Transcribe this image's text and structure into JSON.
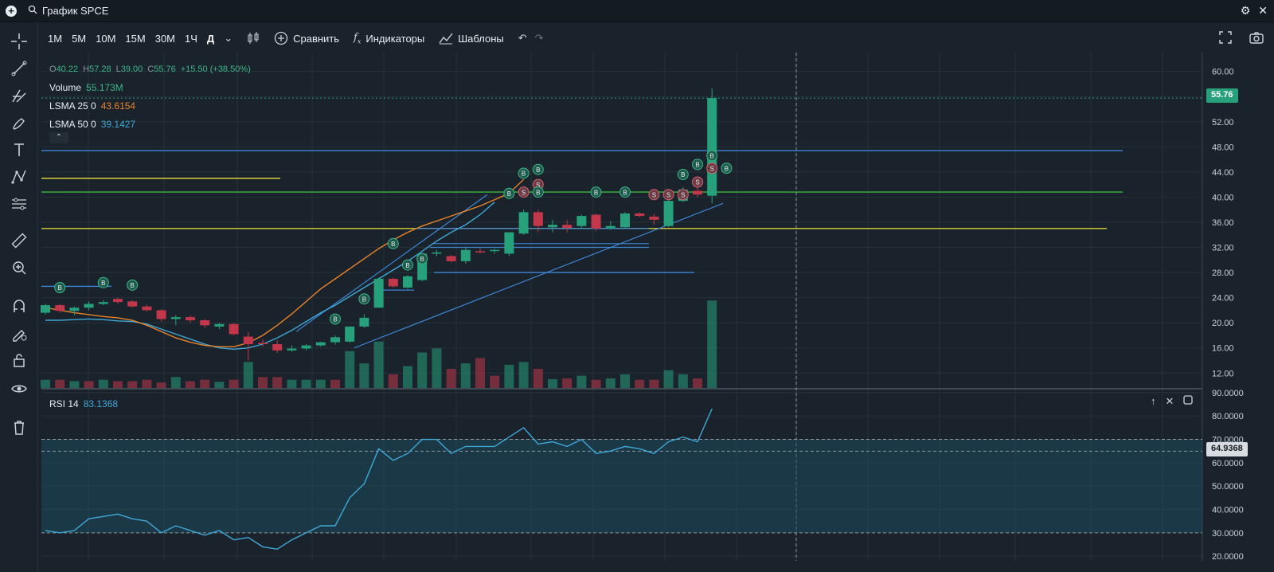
{
  "titlebar": {
    "title": "График SPCE"
  },
  "toolbar": {
    "timeframes": [
      "1M",
      "5M",
      "10M",
      "15M",
      "30M",
      "1Ч",
      "Д"
    ],
    "active_timeframe": "Д",
    "compare_label": "Сравнить",
    "indicators_label": "Индикаторы",
    "templates_label": "Шаблоны"
  },
  "legend": {
    "ohlc": {
      "o_label": "O",
      "o": "40.22",
      "h_label": "H",
      "h": "57.28",
      "l_label": "L",
      "l": "39.00",
      "c_label": "C",
      "c": "55.76",
      "change": "+15.50 (+38.50%)"
    },
    "volume_label": "Volume",
    "volume_value": "55.173M",
    "lsma25_label": "LSMA 25 0",
    "lsma25_value": "43.6154",
    "lsma50_label": "LSMA 50 0",
    "lsma50_value": "39.1427"
  },
  "rsi": {
    "label": "RSI 14",
    "value": "83.1368"
  },
  "price_tags": {
    "last": "55.76",
    "rsi_mid": "64.9368"
  },
  "colors": {
    "up": "#26a17b",
    "down": "#c2374a",
    "lsma25": "#e8832a",
    "lsma50": "#3fa7d6",
    "trend": "#3d86d6",
    "yellow": "#d8d13a",
    "green": "#3cb83c"
  },
  "chart_data": [
    {
      "type": "candlestick",
      "title": "",
      "y_ticks": [
        12,
        16,
        20,
        24,
        28,
        32,
        36,
        40,
        44,
        48,
        52,
        56,
        60
      ],
      "ylim": [
        9.5,
        63
      ],
      "candles": [
        [
          21.6,
          23.0,
          21.3,
          22.8
        ],
        [
          22.8,
          23.0,
          21.6,
          21.9
        ],
        [
          21.9,
          22.6,
          21.2,
          22.4
        ],
        [
          22.4,
          23.4,
          22.0,
          23.0
        ],
        [
          23.0,
          23.6,
          22.8,
          23.3
        ],
        [
          23.8,
          24.0,
          23.0,
          23.3
        ],
        [
          23.4,
          23.6,
          22.4,
          22.6
        ],
        [
          22.6,
          22.9,
          21.8,
          22.0
        ],
        [
          22.0,
          22.2,
          20.2,
          20.6
        ],
        [
          20.6,
          21.2,
          19.6,
          20.9
        ],
        [
          20.9,
          21.2,
          20.0,
          20.4
        ],
        [
          20.4,
          20.6,
          19.2,
          19.6
        ],
        [
          19.4,
          20.0,
          19.0,
          19.8
        ],
        [
          19.8,
          20.0,
          18.0,
          18.2
        ],
        [
          17.8,
          18.6,
          14.0,
          16.6
        ],
        [
          16.8,
          17.4,
          16.2,
          16.6
        ],
        [
          16.6,
          17.2,
          15.2,
          15.6
        ],
        [
          15.6,
          16.4,
          15.4,
          15.9
        ],
        [
          15.9,
          16.6,
          15.6,
          16.4
        ],
        [
          16.4,
          17.0,
          16.2,
          16.9
        ],
        [
          16.9,
          18.0,
          16.5,
          17.7
        ],
        [
          17.0,
          19.4,
          16.8,
          19.4
        ],
        [
          19.4,
          21.4,
          19.2,
          20.8
        ],
        [
          22.4,
          27.2,
          22.4,
          27.0
        ],
        [
          27.0,
          27.2,
          25.6,
          25.8
        ],
        [
          25.6,
          27.6,
          25.4,
          27.4
        ],
        [
          26.8,
          31.2,
          26.6,
          31.0
        ],
        [
          31.0,
          31.6,
          30.6,
          31.2
        ],
        [
          30.6,
          30.8,
          29.6,
          29.8
        ],
        [
          29.8,
          32.0,
          29.4,
          31.6
        ],
        [
          31.4,
          31.9,
          31.0,
          31.3
        ],
        [
          31.4,
          31.8,
          31.0,
          31.6
        ],
        [
          31.0,
          34.4,
          30.6,
          34.4
        ],
        [
          34.2,
          38.0,
          34.0,
          37.6
        ],
        [
          37.6,
          38.0,
          34.4,
          35.4
        ],
        [
          35.2,
          36.4,
          34.4,
          35.6
        ],
        [
          35.6,
          36.4,
          34.4,
          35.1
        ],
        [
          35.4,
          37.2,
          35.0,
          37.0
        ],
        [
          37.2,
          37.4,
          34.6,
          35.0
        ],
        [
          35.0,
          36.2,
          34.8,
          35.4
        ],
        [
          35.2,
          37.6,
          35.0,
          37.4
        ],
        [
          37.4,
          37.6,
          36.8,
          37.0
        ],
        [
          36.9,
          37.4,
          35.6,
          36.4
        ],
        [
          35.4,
          39.6,
          35.2,
          39.4
        ],
        [
          39.4,
          41.6,
          39.2,
          41.2
        ],
        [
          41.0,
          41.6,
          40.0,
          40.4
        ],
        [
          40.22,
          57.28,
          39.0,
          55.76
        ]
      ],
      "volume": [
        [
          1.2,
          1
        ],
        [
          1.2,
          0
        ],
        [
          1.0,
          1
        ],
        [
          1.0,
          0
        ],
        [
          1.2,
          1
        ],
        [
          1.0,
          0
        ],
        [
          1.0,
          0
        ],
        [
          1.2,
          0
        ],
        [
          0.8,
          0
        ],
        [
          1.6,
          1
        ],
        [
          1.0,
          0
        ],
        [
          1.2,
          0
        ],
        [
          0.9,
          1
        ],
        [
          1.2,
          0
        ],
        [
          3.8,
          1
        ],
        [
          1.6,
          0
        ],
        [
          1.6,
          0
        ],
        [
          1.2,
          1
        ],
        [
          1.2,
          1
        ],
        [
          1.2,
          1
        ],
        [
          1.2,
          0
        ],
        [
          5.4,
          1
        ],
        [
          3.6,
          1
        ],
        [
          6.8,
          1
        ],
        [
          2.0,
          0
        ],
        [
          3.2,
          1
        ],
        [
          5.2,
          1
        ],
        [
          5.8,
          1
        ],
        [
          2.8,
          0
        ],
        [
          3.6,
          1
        ],
        [
          4.4,
          0
        ],
        [
          1.8,
          0
        ],
        [
          3.4,
          1
        ],
        [
          3.8,
          1
        ],
        [
          2.8,
          0
        ],
        [
          1.3,
          1
        ],
        [
          1.4,
          0
        ],
        [
          1.8,
          1
        ],
        [
          1.2,
          0
        ],
        [
          1.4,
          1
        ],
        [
          2.0,
          1
        ],
        [
          1.2,
          0
        ],
        [
          1.2,
          0
        ],
        [
          2.6,
          1
        ],
        [
          2.0,
          1
        ],
        [
          1.4,
          0
        ],
        [
          12.8,
          1
        ]
      ],
      "lsma25": [
        22.4,
        22.0,
        21.6,
        21.3,
        21.0,
        20.8,
        20.4,
        19.6,
        18.6,
        17.6,
        16.9,
        16.4,
        16.2,
        16.2,
        16.8,
        18.0,
        19.6,
        21.4,
        23.4,
        25.4,
        27.0,
        28.6,
        30.2,
        31.8,
        33.2,
        34.4,
        35.4,
        36.2,
        37.0,
        37.8,
        38.6,
        39.6,
        40.6,
        42.8
      ],
      "lsma50": [
        20.4,
        20.4,
        20.5,
        20.6,
        20.5,
        20.3,
        20.2,
        19.8,
        19.0,
        18.2,
        17.4,
        16.6,
        16.0,
        15.8,
        16.0,
        16.6,
        17.6,
        18.8,
        20.2,
        21.6,
        22.8,
        24.2,
        25.6,
        27.0,
        28.4,
        29.8,
        31.4,
        33.0,
        34.4,
        35.6,
        37.2,
        39.2
      ],
      "horizontal_lines": [
        {
          "y": 47.4,
          "color": "trend"
        },
        {
          "y": 43.0,
          "color": "yellow",
          "short": true
        },
        {
          "y": 40.8,
          "color": "green"
        },
        {
          "y": 35.0,
          "color": "yellow"
        },
        {
          "y": 25.8,
          "color": "trend",
          "short": true
        },
        {
          "y": 28.0,
          "color": "trend",
          "mid": true
        }
      ],
      "markers": [
        {
          "i": 1,
          "y": 25.6,
          "t": "B"
        },
        {
          "i": 4,
          "y": 26.4,
          "t": "B"
        },
        {
          "i": 6,
          "y": 26.0,
          "t": "B"
        },
        {
          "i": 20,
          "y": 20.6,
          "t": "B"
        },
        {
          "i": 22,
          "y": 23.8,
          "t": "B"
        },
        {
          "i": 24,
          "y": 32.6,
          "t": "B"
        },
        {
          "i": 25,
          "y": 29.2,
          "t": "B"
        },
        {
          "i": 26,
          "y": 30.2,
          "t": "B"
        },
        {
          "i": 32,
          "y": 40.6,
          "t": "B"
        },
        {
          "i": 33,
          "y": 43.8,
          "t": "B"
        },
        {
          "i": 33,
          "y": 40.8,
          "t": "S"
        },
        {
          "i": 34,
          "y": 44.4,
          "t": "B"
        },
        {
          "i": 34,
          "y": 42.0,
          "t": "S"
        },
        {
          "i": 34,
          "y": 40.8,
          "t": "B"
        },
        {
          "i": 38,
          "y": 40.8,
          "t": "B"
        },
        {
          "i": 40,
          "y": 40.8,
          "t": "B"
        },
        {
          "i": 42,
          "y": 40.4,
          "t": "S"
        },
        {
          "i": 43,
          "y": 40.4,
          "t": "S"
        },
        {
          "i": 44,
          "y": 43.6,
          "t": "B"
        },
        {
          "i": 44,
          "y": 40.4,
          "t": "S"
        },
        {
          "i": 45,
          "y": 45.2,
          "t": "B"
        },
        {
          "i": 45,
          "y": 42.4,
          "t": "S"
        },
        {
          "i": 46,
          "y": 46.6,
          "t": "B"
        },
        {
          "i": 46,
          "y": 44.6,
          "t": "S"
        },
        {
          "i": 47,
          "y": 44.6,
          "t": "B"
        }
      ]
    },
    {
      "type": "line",
      "title": "RSI 14",
      "y_ticks": [
        20,
        30,
        40,
        50,
        60,
        70,
        80,
        90
      ],
      "ylim": [
        18,
        91
      ],
      "bands": [
        30,
        70
      ],
      "values": [
        31,
        30,
        31,
        36,
        37,
        38,
        36,
        35,
        30,
        33,
        31,
        29,
        31,
        27,
        28,
        24,
        23,
        27,
        30,
        33,
        33,
        45,
        51,
        66,
        61,
        64,
        70,
        70,
        64,
        67,
        67,
        67,
        71,
        75,
        68,
        69,
        67,
        70,
        64,
        65,
        67,
        66,
        64,
        69,
        71,
        69,
        83.14
      ]
    }
  ]
}
